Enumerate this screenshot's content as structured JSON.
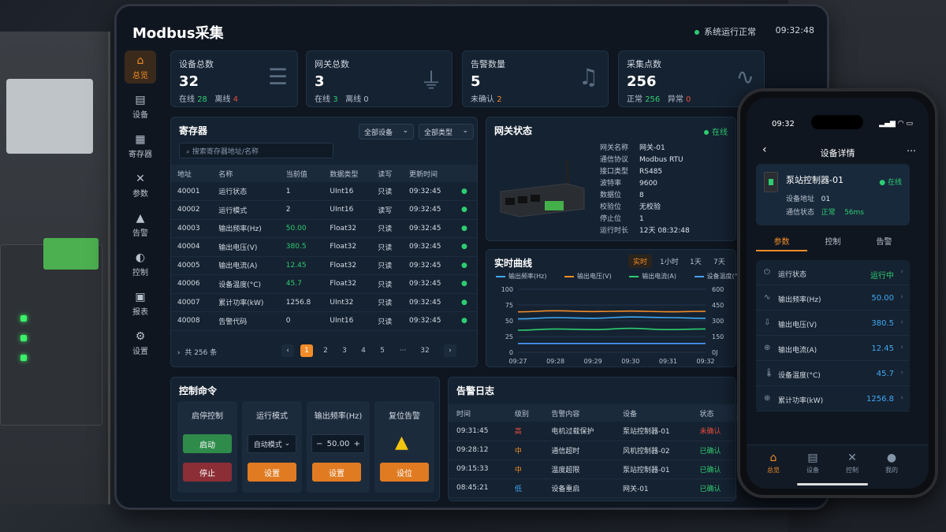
{
  "app": {
    "title": "Modbus采集",
    "status": "系统运行正常",
    "time": "09:32:48"
  },
  "sidebar": [
    {
      "label": "总览",
      "icon": "home-icon",
      "active": true
    },
    {
      "label": "设备",
      "icon": "device-icon"
    },
    {
      "label": "寄存器",
      "icon": "register-icon"
    },
    {
      "label": "参数",
      "icon": "tools-icon"
    },
    {
      "label": "告警",
      "icon": "warning-icon"
    },
    {
      "label": "控制",
      "icon": "control-icon"
    },
    {
      "label": "报表",
      "icon": "report-icon"
    },
    {
      "label": "设置",
      "icon": "gear-icon"
    }
  ],
  "stats": [
    {
      "label": "设备总数",
      "value": "32",
      "a_label": "在线",
      "a_value": "28",
      "b_label": "离线",
      "b_value": "4",
      "icon": "server-icon"
    },
    {
      "label": "网关总数",
      "value": "3",
      "a_label": "在线",
      "a_value": "3",
      "b_label": "离线",
      "b_value": "0",
      "icon": "gateway-icon"
    },
    {
      "label": "告警数量",
      "value": "5",
      "a_label": "未确认",
      "a_value": "2",
      "b_label": "",
      "b_value": "",
      "icon": "bell-icon"
    },
    {
      "label": "采集点数",
      "value": "256",
      "a_label": "正常",
      "a_value": "256",
      "b_label": "异常",
      "b_value": "0",
      "icon": "wave-icon"
    }
  ],
  "registers": {
    "title": "寄存器",
    "filter_device": "全部设备",
    "filter_type": "全部类型",
    "search_placeholder": "搜索寄存器地址/名称",
    "columns": [
      "地址",
      "名称",
      "当前值",
      "数据类型",
      "读写",
      "更新时间"
    ],
    "rows": [
      [
        "40001",
        "运行状态",
        "1",
        "UInt16",
        "只读",
        "09:32:45"
      ],
      [
        "40002",
        "运行模式",
        "2",
        "UInt16",
        "读写",
        "09:32:45"
      ],
      [
        "40003",
        "输出频率(Hz)",
        "50.00",
        "Float32",
        "只读",
        "09:32:45"
      ],
      [
        "40004",
        "输出电压(V)",
        "380.5",
        "Float32",
        "只读",
        "09:32:45"
      ],
      [
        "40005",
        "输出电流(A)",
        "12.45",
        "Float32",
        "只读",
        "09:32:45"
      ],
      [
        "40006",
        "设备温度(°C)",
        "45.7",
        "Float32",
        "只读",
        "09:32:45"
      ],
      [
        "40007",
        "累计功率(kW)",
        "1256.8",
        "UInt32",
        "只读",
        "09:32:45"
      ],
      [
        "40008",
        "告警代码",
        "0",
        "UInt16",
        "只读",
        "09:32:45"
      ]
    ],
    "total": "共 256 条",
    "pages": [
      "1",
      "2",
      "3",
      "4",
      "5",
      "···",
      "32"
    ]
  },
  "gateway": {
    "title": "网关状态",
    "status": "在线",
    "info": [
      [
        "网关名称",
        "网关-01"
      ],
      [
        "通信协议",
        "Modbus RTU"
      ],
      [
        "接口类型",
        "RS485"
      ],
      [
        "波特率",
        "9600"
      ],
      [
        "数据位",
        "8"
      ],
      [
        "校验位",
        "无校验"
      ],
      [
        "停止位",
        "1"
      ],
      [
        "运行时长",
        "12天 08:32:48"
      ]
    ]
  },
  "trend": {
    "title": "实时曲线",
    "ranges": [
      "实时",
      "1小时",
      "1天",
      "7天"
    ]
  },
  "chart_data": {
    "type": "line",
    "x": [
      "09:27",
      "09:28",
      "09:29",
      "09:30",
      "09:31",
      "09:32"
    ],
    "series": [
      {
        "name": "输出频率(Hz)",
        "color": "#3fa9f5",
        "values": [
          53,
          55,
          54,
          56,
          55,
          54
        ]
      },
      {
        "name": "输出电压(V)",
        "color": "#f28c28",
        "values": [
          385,
          395,
          388,
          392,
          386,
          390
        ]
      },
      {
        "name": "输出电流(A)",
        "color": "#2ecc71",
        "values": [
          35,
          37,
          36,
          38,
          36,
          37
        ]
      },
      {
        "name": "设备温度(°C)",
        "color": "#4a9eff",
        "values": [
          14,
          14,
          14,
          14,
          14,
          14
        ]
      }
    ],
    "y_left": {
      "ticks": [
        "100",
        "75",
        "50",
        "25",
        "0"
      ],
      "range": [
        0,
        100
      ]
    },
    "y_right": {
      "ticks": [
        "600",
        "450",
        "300",
        "150",
        "0J"
      ],
      "range": [
        0,
        600
      ]
    },
    "grid": true
  },
  "control": {
    "title": "控制命令",
    "boxes": [
      {
        "title": "启停控制",
        "btn1": "启动",
        "btn2": "停止"
      },
      {
        "title": "运行模式",
        "select": "自动模式",
        "btn": "设置"
      },
      {
        "title": "输出频率(Hz)",
        "minus": "−",
        "value": "50.00",
        "plus": "+",
        "btn": "设置"
      },
      {
        "title": "复位告警",
        "btn": "设位"
      }
    ]
  },
  "alarms": {
    "title": "告警日志",
    "columns": [
      "时间",
      "级别",
      "告警内容",
      "设备",
      "状态"
    ],
    "rows": [
      [
        "09:31:45",
        "高",
        "电机过载保护",
        "泵站控制器-01",
        "未确认"
      ],
      [
        "09:28:12",
        "中",
        "通信超时",
        "风机控制器-02",
        "已确认"
      ],
      [
        "09:15:33",
        "中",
        "温度超限",
        "泵站控制器-01",
        "已确认"
      ],
      [
        "08:45:21",
        "低",
        "设备重启",
        "网关-01",
        "已确认"
      ]
    ]
  },
  "phone": {
    "time": "09:32",
    "title": "设备详情",
    "device_name": "泵站控制器-01",
    "device_status": "在线",
    "addr_label": "设备地址",
    "addr_value": "01",
    "comm_label": "通信状态",
    "comm_value": "正常",
    "comm_latency": "56ms",
    "tabs": [
      "参数",
      "控制",
      "告警"
    ],
    "params": [
      {
        "label": "运行状态",
        "value": "运行中",
        "icon": "power-icon"
      },
      {
        "label": "输出频率(Hz)",
        "value": "50.00",
        "icon": "pulse-icon"
      },
      {
        "label": "输出电压(V)",
        "value": "380.5",
        "icon": "voltage-icon"
      },
      {
        "label": "输出电流(A)",
        "value": "12.45",
        "icon": "current-icon"
      },
      {
        "label": "设备温度(°C)",
        "value": "45.7",
        "icon": "thermometer-icon"
      },
      {
        "label": "累计功率(kW)",
        "value": "1256.8",
        "icon": "power-meter-icon"
      }
    ],
    "nav": [
      "总览",
      "设备",
      "控制",
      "我的"
    ]
  }
}
